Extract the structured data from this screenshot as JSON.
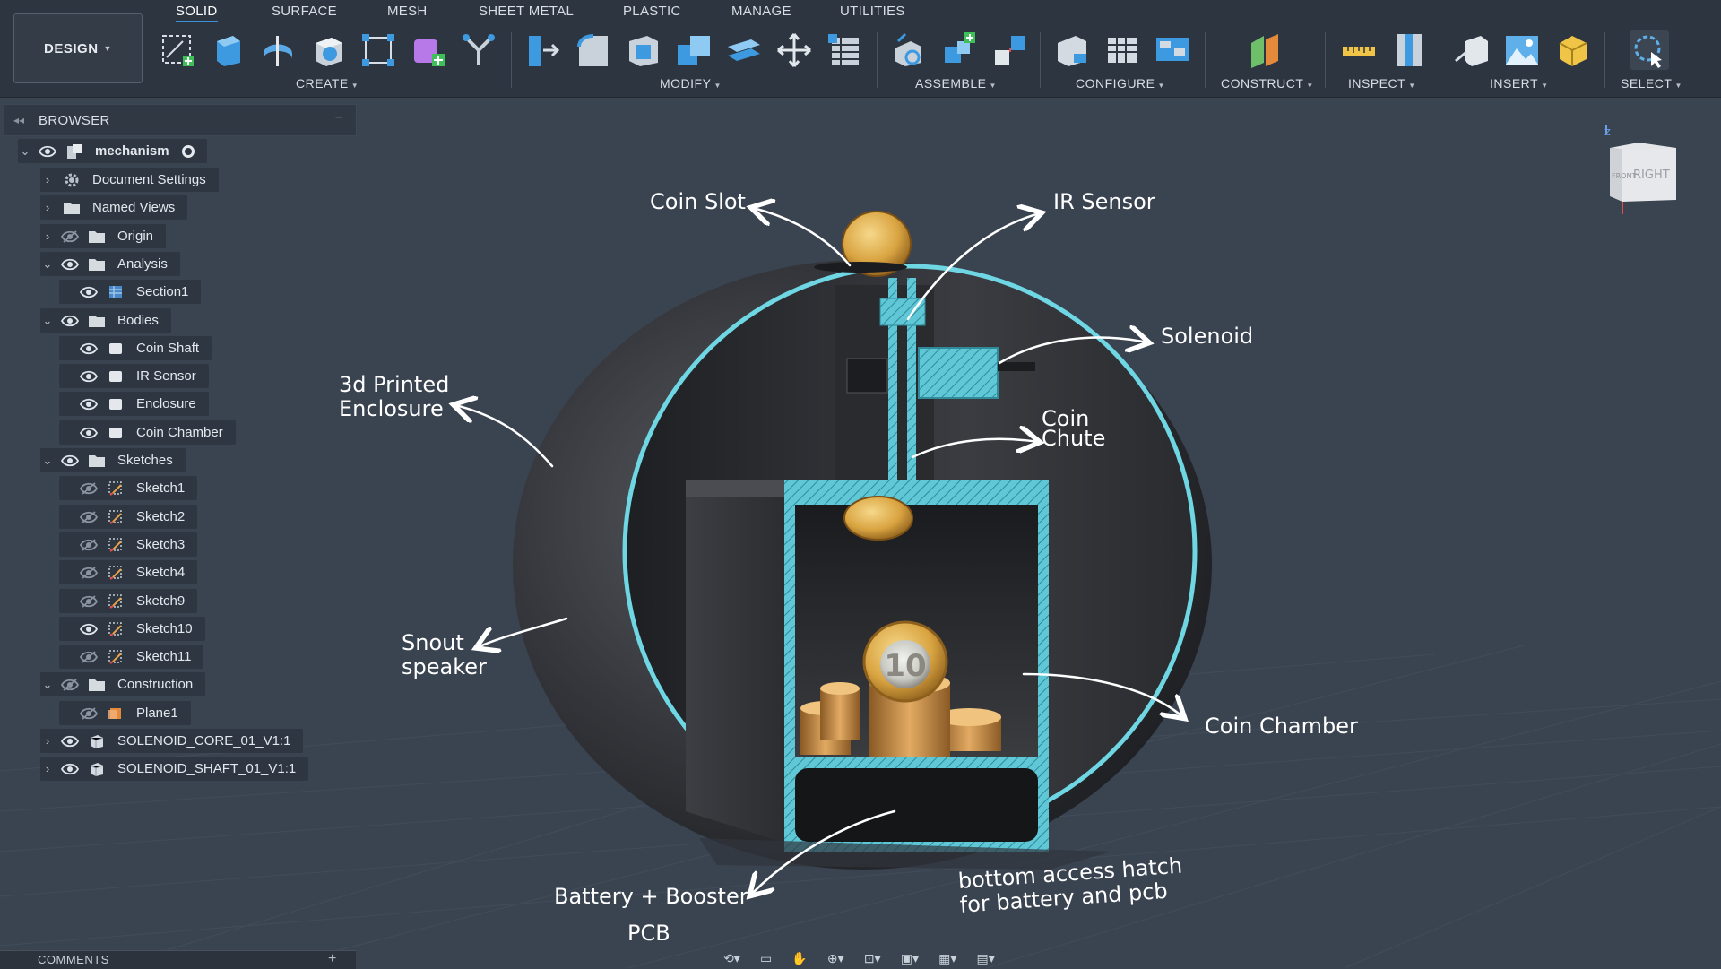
{
  "toolbar": {
    "mode_button": "DESIGN",
    "tabs": [
      "SOLID",
      "SURFACE",
      "MESH",
      "SHEET METAL",
      "PLASTIC",
      "MANAGE",
      "UTILITIES"
    ],
    "active_tab": "SOLID",
    "groups": [
      "CREATE",
      "MODIFY",
      "ASSEMBLE",
      "CONFIGURE",
      "CONSTRUCT",
      "INSPECT",
      "INSERT",
      "SELECT"
    ]
  },
  "browser": {
    "title": "BROWSER",
    "root": "mechanism",
    "items": [
      {
        "label": "Document Settings",
        "icon": "gear-icon"
      },
      {
        "label": "Named Views",
        "icon": "folder-icon"
      },
      {
        "label": "Origin",
        "icon": "folder-icon"
      },
      {
        "label": "Analysis",
        "icon": "folder-icon"
      },
      {
        "label": "Section1",
        "icon": "section-icon"
      },
      {
        "label": "Bodies",
        "icon": "folder-icon"
      },
      {
        "label": "Coin Shaft",
        "icon": "body-icon"
      },
      {
        "label": "IR Sensor",
        "icon": "body-icon"
      },
      {
        "label": "Enclosure",
        "icon": "body-icon"
      },
      {
        "label": "Coin Chamber",
        "icon": "body-icon"
      },
      {
        "label": "Sketches",
        "icon": "folder-icon"
      },
      {
        "label": "Sketch1",
        "icon": "sketch-icon"
      },
      {
        "label": "Sketch2",
        "icon": "sketch-icon"
      },
      {
        "label": "Sketch3",
        "icon": "sketch-icon"
      },
      {
        "label": "Sketch4",
        "icon": "sketch-icon"
      },
      {
        "label": "Sketch9",
        "icon": "sketch-icon"
      },
      {
        "label": "Sketch10",
        "icon": "sketch-icon"
      },
      {
        "label": "Sketch11",
        "icon": "sketch-icon"
      },
      {
        "label": "Construction",
        "icon": "folder-icon"
      },
      {
        "label": "Plane1",
        "icon": "plane-icon"
      },
      {
        "label": "SOLENOID_CORE_01_V1:1",
        "icon": "component-icon"
      },
      {
        "label": "SOLENOID_SHAFT_01_V1:1",
        "icon": "component-icon"
      }
    ]
  },
  "comments": {
    "title": "COMMENTS"
  },
  "viewcube": {
    "front": "FRONT",
    "right": "RIGHT",
    "z_axis": "Z"
  },
  "coin_denomination": "10",
  "annotations": {
    "coin_slot": "Coin Slot",
    "ir_sensor": "IR Sensor",
    "solenoid": "Solenoid",
    "enclosure": "3d Printed\nEnclosure",
    "coin_chute": "Coin\nChute",
    "snout_speaker": "Snout\nspeaker",
    "coin_chamber": "Coin Chamber",
    "battery": "Battery + Booster",
    "pcb": "PCB",
    "hatch": "bottom access hatch\nfor battery and pcb"
  },
  "colors": {
    "toolbar_bg": "#2d3540",
    "viewport_bg": "#3a4350",
    "section_cyan": "#6fd6e4",
    "accent_blue": "#3d8fd6",
    "enclosure_dark": "#2a2c30",
    "coin_gold": "#d9a441",
    "coin_silver": "#cfd3d6"
  }
}
